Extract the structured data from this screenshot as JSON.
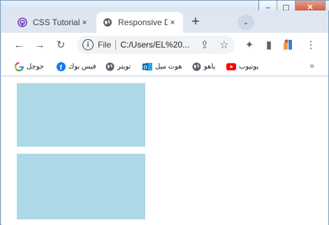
{
  "tabs": [
    {
      "title": "CSS Tutorial",
      "close": "×",
      "active": false
    },
    {
      "title": "Responsive D",
      "close": "×",
      "active": true
    }
  ],
  "new_tab_label": "+",
  "tab_search_label": "⌄",
  "window_buttons": {
    "minimize": "–",
    "maximize": "▢",
    "close": "✕"
  },
  "toolbar": {
    "back": "←",
    "forward": "→",
    "reload": "↻",
    "info": "i",
    "scheme": "File",
    "url": "C:/Users/EL%20...",
    "share": "⇪",
    "star": "☆",
    "extensions": "✦",
    "sidepanel": "▮",
    "menu": "⋮"
  },
  "bookmarks": [
    {
      "label": "جوجل",
      "icon": "google-icon"
    },
    {
      "label": "فيس بوك",
      "icon": "facebook-icon"
    },
    {
      "label": "تويتر",
      "icon": "globe-icon"
    },
    {
      "label": "هوت ميل",
      "icon": "outlook-icon"
    },
    {
      "label": "ياهو",
      "icon": "globe-icon"
    },
    {
      "label": "يوتيوب",
      "icon": "youtube-icon"
    }
  ],
  "bookmarks_more": "»",
  "colors": {
    "box": "#add8e6",
    "active_tab": "#ffffff",
    "frame": "#dee7f1",
    "close_button": "#c7492f"
  }
}
